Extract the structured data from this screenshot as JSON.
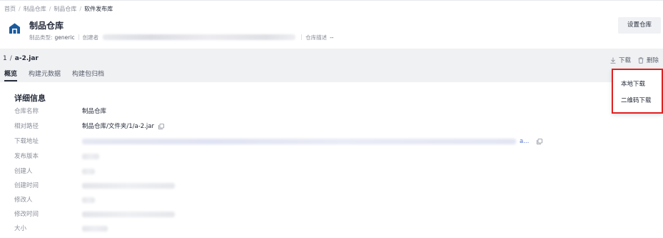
{
  "breadcrumb": {
    "items": [
      "首页",
      "制品仓库",
      "制品仓库"
    ],
    "current": "软件发布库",
    "separator": "/"
  },
  "header": {
    "title": "制品仓库",
    "type_label": "制品类型:",
    "type_value": "generic",
    "creator_label": "创建者",
    "desc_label": "仓库描述",
    "desc_value": "--",
    "settings_button": "设置仓库"
  },
  "file": {
    "index": "1",
    "separator": "/",
    "name": "a-2.jar"
  },
  "tabs": [
    {
      "label": "概览",
      "active": true
    },
    {
      "label": "构建元数据",
      "active": false
    },
    {
      "label": "构建包归档",
      "active": false
    }
  ],
  "actions": {
    "download": "下载",
    "delete": "删除"
  },
  "dropdown": {
    "items": [
      "本地下载",
      "二维码下载"
    ]
  },
  "details": {
    "title": "详细信息",
    "rows": [
      {
        "label": "仓库名称",
        "value": "制品仓库"
      },
      {
        "label": "相对路径",
        "value": "制品仓库/文件夹/1/a-2.jar"
      },
      {
        "label": "下载地址",
        "value": "a..."
      },
      {
        "label": "发布版本",
        "value": ""
      },
      {
        "label": "创建人",
        "value": ""
      },
      {
        "label": "创建时间",
        "value": ""
      },
      {
        "label": "修改人",
        "value": ""
      },
      {
        "label": "修改时间",
        "value": ""
      },
      {
        "label": "大小",
        "value": ""
      }
    ]
  },
  "colors": {
    "accent_blue": "#4f6fd8",
    "highlight_red": "#e02020",
    "icon_blue": "#1a5a9e"
  },
  "icons": {
    "repo": "repository-icon",
    "download": "download-icon",
    "delete": "trash-icon",
    "copy": "copy-icon"
  }
}
